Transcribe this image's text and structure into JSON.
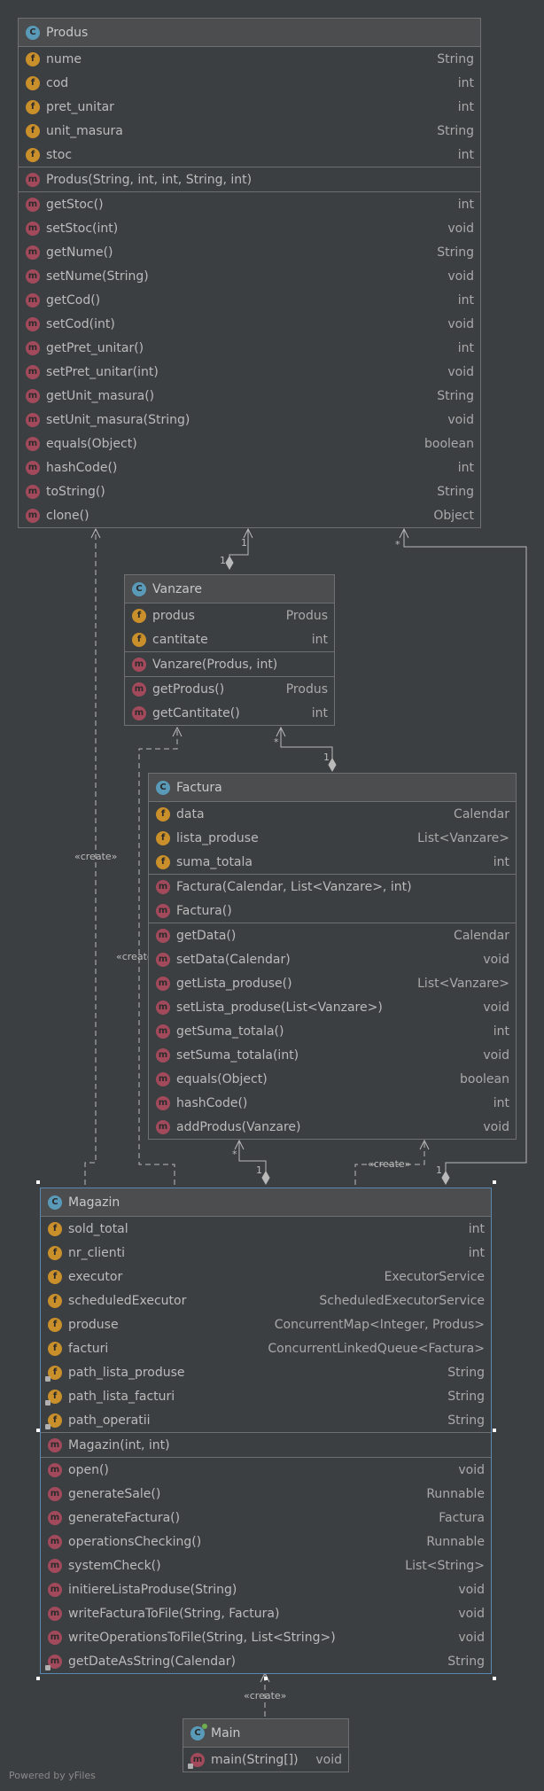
{
  "classes": {
    "produs": {
      "name": "Produs",
      "fields": [
        {
          "name": "nume",
          "type": "String"
        },
        {
          "name": "cod",
          "type": "int"
        },
        {
          "name": "pret_unitar",
          "type": "int"
        },
        {
          "name": "unit_masura",
          "type": "String"
        },
        {
          "name": "stoc",
          "type": "int"
        }
      ],
      "constructors": [
        {
          "name": "Produs(String, int, int, String, int)",
          "type": ""
        }
      ],
      "methods": [
        {
          "name": "getStoc()",
          "type": "int"
        },
        {
          "name": "setStoc(int)",
          "type": "void"
        },
        {
          "name": "getNume()",
          "type": "String"
        },
        {
          "name": "setNume(String)",
          "type": "void"
        },
        {
          "name": "getCod()",
          "type": "int"
        },
        {
          "name": "setCod(int)",
          "type": "void"
        },
        {
          "name": "getPret_unitar()",
          "type": "int"
        },
        {
          "name": "setPret_unitar(int)",
          "type": "void"
        },
        {
          "name": "getUnit_masura()",
          "type": "String"
        },
        {
          "name": "setUnit_masura(String)",
          "type": "void"
        },
        {
          "name": "equals(Object)",
          "type": "boolean"
        },
        {
          "name": "hashCode()",
          "type": "int"
        },
        {
          "name": "toString()",
          "type": "String"
        },
        {
          "name": "clone()",
          "type": "Object"
        }
      ]
    },
    "vanzare": {
      "name": "Vanzare",
      "fields": [
        {
          "name": "produs",
          "type": "Produs"
        },
        {
          "name": "cantitate",
          "type": "int"
        }
      ],
      "constructors": [
        {
          "name": "Vanzare(Produs, int)",
          "type": ""
        }
      ],
      "methods": [
        {
          "name": "getProdus()",
          "type": "Produs"
        },
        {
          "name": "getCantitate()",
          "type": "int"
        }
      ]
    },
    "factura": {
      "name": "Factura",
      "fields": [
        {
          "name": "data",
          "type": "Calendar"
        },
        {
          "name": "lista_produse",
          "type": "List<Vanzare>"
        },
        {
          "name": "suma_totala",
          "type": "int"
        }
      ],
      "constructors": [
        {
          "name": "Factura(Calendar, List<Vanzare>, int)",
          "type": ""
        },
        {
          "name": "Factura()",
          "type": ""
        }
      ],
      "methods": [
        {
          "name": "getData()",
          "type": "Calendar"
        },
        {
          "name": "setData(Calendar)",
          "type": "void"
        },
        {
          "name": "getLista_produse()",
          "type": "List<Vanzare>"
        },
        {
          "name": "setLista_produse(List<Vanzare>)",
          "type": "void"
        },
        {
          "name": "getSuma_totala()",
          "type": "int"
        },
        {
          "name": "setSuma_totala(int)",
          "type": "void"
        },
        {
          "name": "equals(Object)",
          "type": "boolean"
        },
        {
          "name": "hashCode()",
          "type": "int"
        },
        {
          "name": "addProdus(Vanzare)",
          "type": "void"
        }
      ]
    },
    "magazin": {
      "name": "Magazin",
      "fields": [
        {
          "name": "sold_total",
          "type": "int"
        },
        {
          "name": "nr_clienti",
          "type": "int"
        },
        {
          "name": "executor",
          "type": "ExecutorService"
        },
        {
          "name": "scheduledExecutor",
          "type": "ScheduledExecutorService"
        },
        {
          "name": "produse",
          "type": "ConcurrentMap<Integer, Produs>"
        },
        {
          "name": "facturi",
          "type": "ConcurrentLinkedQueue<Factura>"
        },
        {
          "name": "path_lista_produse",
          "type": "String",
          "mod": "lock"
        },
        {
          "name": "path_lista_facturi",
          "type": "String",
          "mod": "lock"
        },
        {
          "name": "path_operatii",
          "type": "String",
          "mod": "lock"
        }
      ],
      "constructors": [
        {
          "name": "Magazin(int, int)",
          "type": ""
        }
      ],
      "methods": [
        {
          "name": "open()",
          "type": "void"
        },
        {
          "name": "generateSale()",
          "type": "Runnable"
        },
        {
          "name": "generateFactura()",
          "type": "Factura"
        },
        {
          "name": "operationsChecking()",
          "type": "Runnable"
        },
        {
          "name": "systemCheck()",
          "type": "List<String>"
        },
        {
          "name": "initiereListaProduse(String)",
          "type": "void"
        },
        {
          "name": "writeFacturaToFile(String, Factura)",
          "type": "void"
        },
        {
          "name": "writeOperationsToFile(String, List<String>)",
          "type": "void"
        },
        {
          "name": "getDateAsString(Calendar)",
          "type": "String",
          "mod": "static"
        }
      ]
    },
    "main": {
      "name": "Main",
      "fields": [],
      "constructors": [],
      "methods": [
        {
          "name": "main(String[])",
          "type": "void",
          "mod": "static"
        }
      ]
    }
  },
  "labels": {
    "create": "«create»",
    "create_factura": "«create»",
    "create_vanzare": "«create»",
    "create_main": "«create»",
    "mult_one_a": "1",
    "mult_one_b": "1",
    "mult_star_a": "*",
    "mult_one_c": "1",
    "mult_star_b": "*",
    "mult_one_d": "1",
    "mult_star_c": "*",
    "mult_one_e": "1",
    "mult_one_f": "1"
  },
  "icons": {
    "class": "C",
    "field": "f",
    "method": "m"
  },
  "watermark": "Powered by yFiles",
  "colors": {
    "background": "#3c3f41",
    "header": "#4b4d4f",
    "class_icon": "#5a9ab9",
    "field_icon": "#c98f2a",
    "method_icon": "#a24a5c"
  }
}
